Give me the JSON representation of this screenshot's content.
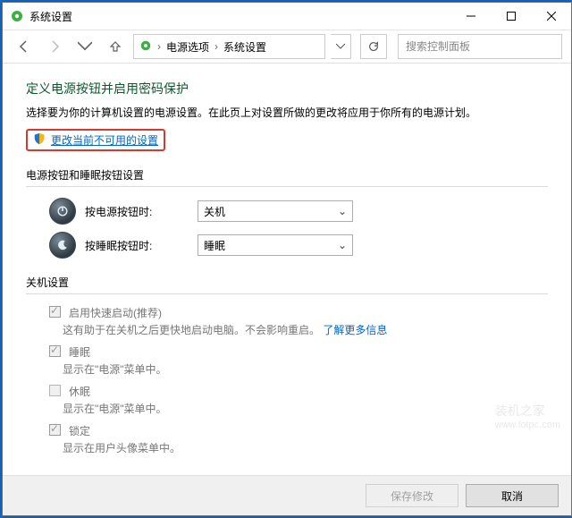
{
  "window": {
    "title": "系统设置"
  },
  "breadcrumb": {
    "level1": "电源选项",
    "level2": "系统设置"
  },
  "search": {
    "placeholder": "搜索控制面板"
  },
  "page": {
    "heading": "定义电源按钮并启用密码保护",
    "description": "选择要为你的计算机设置的电源设置。在此页上对设置所做的更改将应用于你所有的电源计划。",
    "change_unavailable_link": "更改当前不可用的设置"
  },
  "buttons_section": {
    "title": "电源按钮和睡眠按钮设置",
    "rows": [
      {
        "name": "power-button-row",
        "label": "按电源按钮时:",
        "value": "关机",
        "icon": "power-icon"
      },
      {
        "name": "sleep-button-row",
        "label": "按睡眠按钮时:",
        "value": "睡眠",
        "icon": "sleep-icon"
      }
    ]
  },
  "shutdown_section": {
    "title": "关机设置",
    "items": [
      {
        "name": "fast-startup",
        "label": "启用快速启动(推荐)",
        "sub": "这有助于在关机之后更快地启动电脑。不会影响重启。",
        "link": "了解更多信息",
        "checked": true
      },
      {
        "name": "sleep-opt",
        "label": "睡眠",
        "sub": "显示在\"电源\"菜单中。",
        "link": "",
        "checked": true
      },
      {
        "name": "hibernate",
        "label": "休眠",
        "sub": "显示在\"电源\"菜单中。",
        "link": "",
        "checked": false
      },
      {
        "name": "lock",
        "label": "锁定",
        "sub": "显示在用户头像菜单中。",
        "link": "",
        "checked": true
      }
    ]
  },
  "footer": {
    "save": "保存修改",
    "cancel": "取消"
  },
  "watermark": {
    "t1": "装机之家",
    "t2": "www.lotpc.com"
  }
}
